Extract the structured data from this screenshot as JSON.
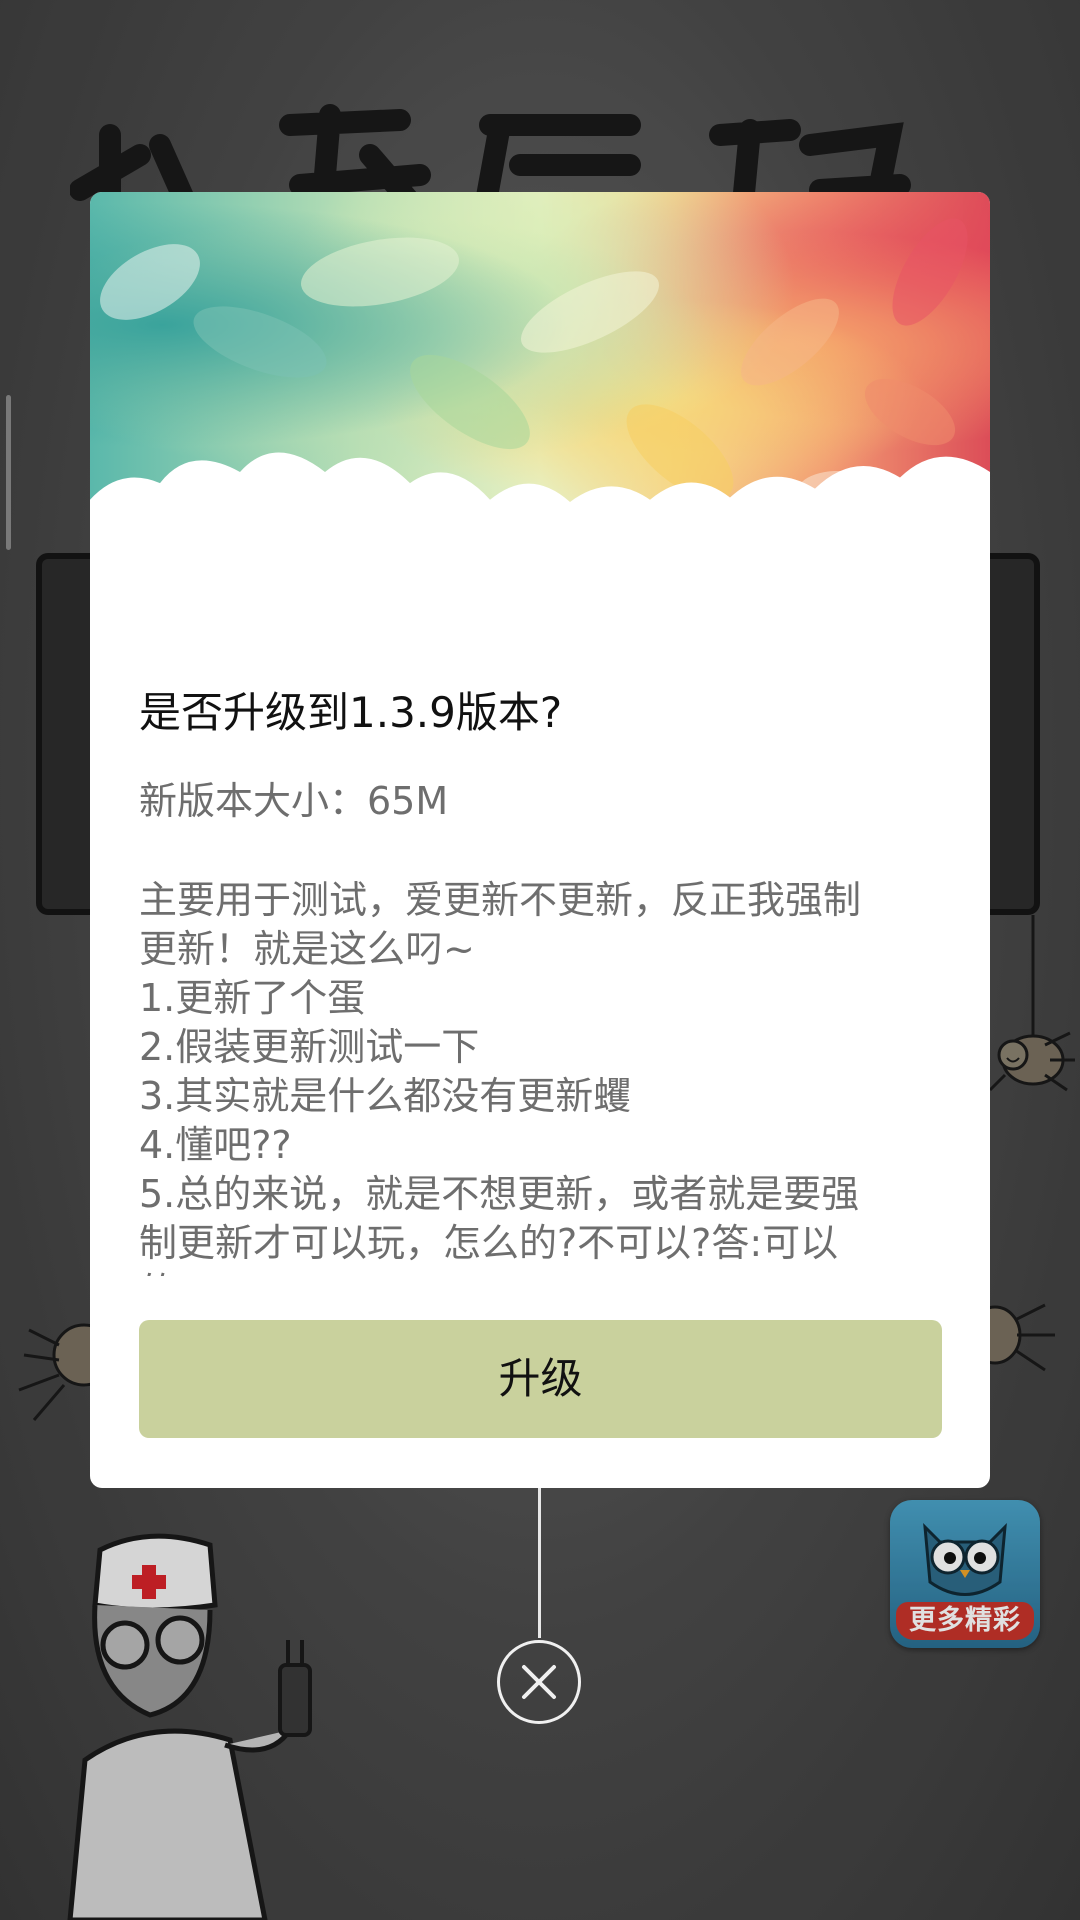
{
  "background": {
    "more_button_label": "更多精彩"
  },
  "dialog": {
    "title": "是否升级到1.3.9版本?",
    "size_text": "新版本大小：65M",
    "notes": [
      "主要用于测试，爱更新不更新，反正我强制",
      "更新！就是这么叼~",
      "1.更新了个蛋",
      "2.假装更新测试一下",
      "3.其实就是什么都没有更新蠼",
      "4.懂吧??",
      "5.总的来说，就是不想更新，或者就是要强",
      "制更新才可以玩，怎么的?不可以?答:可以",
      "的 niubi! @_@"
    ],
    "upgrade_label": "升级",
    "close_icon": "close-circle-icon"
  },
  "colors": {
    "upgrade_button": "#c9d19d",
    "dialog_bg": "#ffffff",
    "secondary_text": "#6e6e6e"
  }
}
